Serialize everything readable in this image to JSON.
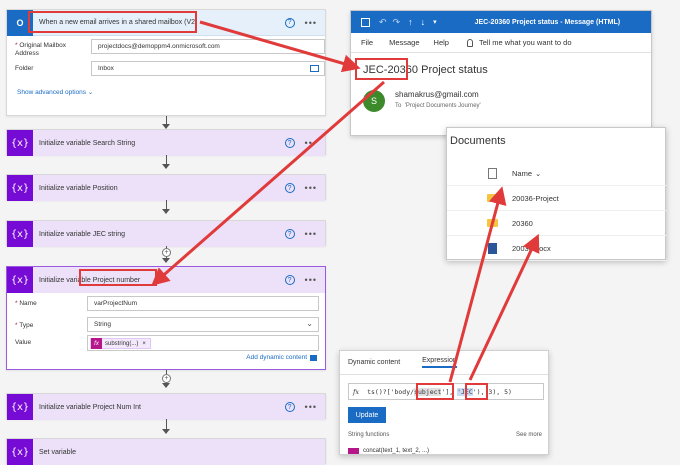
{
  "flow": {
    "trigger": {
      "title": "When a new email arrives in a shared mailbox (V2)",
      "mailbox_label": "Original Mailbox Address",
      "mailbox_value": "projectdocs@demoppm4.onmicrosoft.com",
      "folder_label": "Folder",
      "folder_value": "Inbox",
      "advanced_link": "Show advanced options"
    },
    "steps": [
      {
        "title": "Initialize variable Search String"
      },
      {
        "title": "Initialize variable Position"
      },
      {
        "title": "Initialize variable JEC string"
      }
    ],
    "project_number": {
      "title_prefix": "Initialize variable ",
      "title_highlight": "Project number",
      "name_label": "Name",
      "name_value": "varProjectNum",
      "type_label": "Type",
      "type_value": "String",
      "value_label": "Value",
      "value_token": "substring(...)",
      "dynamic_link": "Add dynamic content"
    },
    "later_steps": [
      {
        "title": "Initialize variable Project Num Int"
      },
      {
        "title": "Set variable"
      }
    ]
  },
  "outlook": {
    "window_title": "JEC-20360 Project status - Message (HTML)",
    "menu": [
      "File",
      "Message",
      "Help"
    ],
    "tell_me": "Tell me what you want to do",
    "subject_prefix": "JEC-20360",
    "subject_rest": " Project status",
    "avatar_letter": "S",
    "sender": "shamakrus@gmail.com",
    "to_label": "To",
    "to_value": "'Project Documents Journey'"
  },
  "documents": {
    "title": "Documents",
    "column": "Name",
    "items": [
      "20036-Project",
      "20360",
      "20036.docx"
    ]
  },
  "dynamic_panel": {
    "tab_dynamic": "Dynamic content",
    "tab_expression": "Expression",
    "expr_prefix": "ts()?['body/",
    "expr_subject": "subject",
    "expr_mid": "'], ",
    "expr_jec": "'JEC",
    "expr_end": "'), 3), 5)",
    "update_button": "Update",
    "section_title": "String functions",
    "see_more": "See more",
    "partial_item": "concat(text_1, text_2, ...)"
  },
  "colors": {
    "accent": "#770bd6",
    "outlook_blue": "#1a6bc4",
    "highlight_red": "#e03a3a"
  }
}
